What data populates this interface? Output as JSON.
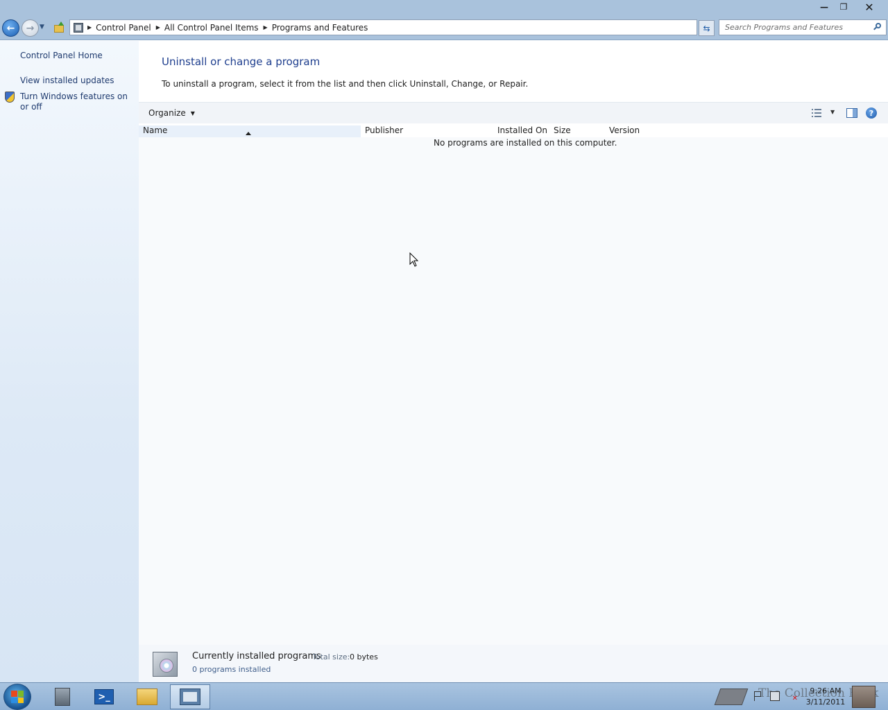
{
  "window": {
    "title_buttons": {
      "minimize": "—",
      "maximize": "❐",
      "close": "✕"
    }
  },
  "address": {
    "breadcrumbs": [
      "Control Panel",
      "All Control Panel Items",
      "Programs and Features"
    ]
  },
  "search": {
    "placeholder": "Search Programs and Features"
  },
  "sidebar": {
    "items": [
      {
        "label": "Control Panel Home"
      },
      {
        "label": "View installed updates"
      },
      {
        "label": "Turn Windows features on or off"
      }
    ]
  },
  "main": {
    "title": "Uninstall or change a program",
    "description": "To uninstall a program, select it from the list and then click Uninstall, Change, or Repair."
  },
  "toolbar": {
    "organize_label": "Organize",
    "help_label": "?"
  },
  "list": {
    "columns": [
      "Name",
      "Publisher",
      "Installed On",
      "Size",
      "Version"
    ],
    "empty_message": "No programs are installed on this computer."
  },
  "details": {
    "title": "Currently installed programs",
    "total_size_label": "Total size:",
    "total_size_value": "0 bytes",
    "count": "0 programs installed"
  },
  "taskbar": {
    "apps": [
      "server-manager",
      "powershell",
      "windows-explorer",
      "control-panel"
    ],
    "active_app": "control-panel",
    "watermark": "The Collection Book",
    "clock_time": "9:26 AM",
    "clock_date": "3/11/2011"
  },
  "colors": {
    "frame": "#a9c2dc",
    "link": "#1e3a6e",
    "title": "#1e3e8e",
    "list_bg": "#f8fafc"
  }
}
